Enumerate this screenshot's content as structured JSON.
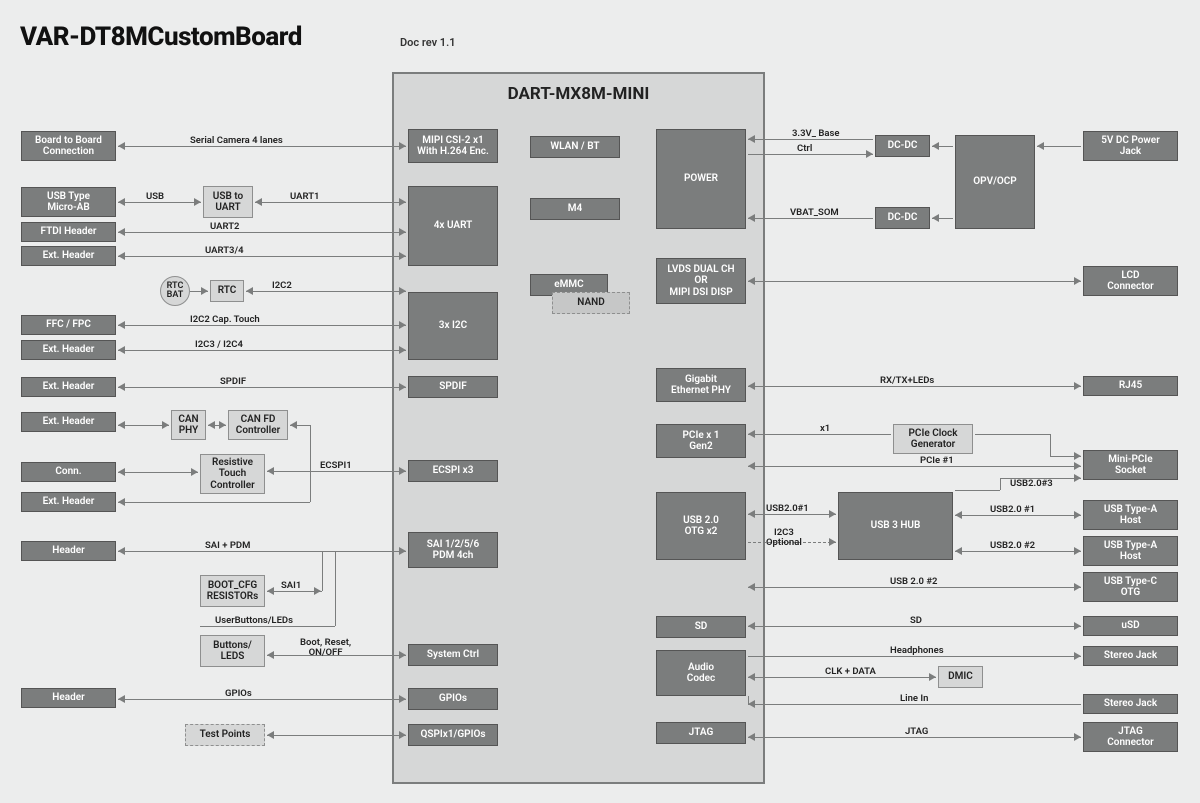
{
  "doc": {
    "title": "VAR-DT8MCustomBoard",
    "rev": "Doc rev 1.1",
    "som_title": "DART-MX8M-MINI"
  },
  "chart_data": {
    "type": "block-diagram",
    "title": "VAR-DT8MCustomBoard",
    "som": "DART-MX8M-MINI",
    "left_connectors": [
      "Board to Board Connection",
      "USB Type Micro-AB",
      "FTDI Header",
      "Ext. Header",
      "FFC / FPC",
      "Ext. Header",
      "Ext. Header",
      "Ext. Header",
      "Conn.",
      "Ext. Header",
      "Header",
      "Header"
    ],
    "left_aux_blocks": [
      "USB to UART",
      "RTC BAT",
      "RTC",
      "CAN PHY",
      "CAN FD Controller",
      "Resistive Touch Controller",
      "BOOT_CFG RESISTORs",
      "Buttons/ LEDS",
      "Test Points"
    ],
    "som_left_blocks": [
      "MIPI CSI-2 x1 With H.264 Enc.",
      "4x UART",
      "3x I2C",
      "SPDIF",
      "ECSPI x3",
      "SAI 1/2/5/6 PDM 4ch",
      "System Ctrl",
      "GPIOs",
      "QSPIx1/GPIOs"
    ],
    "som_center_blocks": [
      "WLAN / BT",
      "M4",
      "eMMC",
      "NAND"
    ],
    "som_right_blocks": [
      "POWER",
      "LVDS DUAL CH OR MIPI DSI DISP",
      "Gigabit Ethernet PHY",
      "PCIe x 1 Gen2",
      "USB 2.0 OTG x2",
      "SD",
      "Audio Codec",
      "JTAG"
    ],
    "right_aux_blocks": [
      "DC-DC",
      "DC-DC",
      "OPV/OCP",
      "PCIe Clock Generator",
      "USB 3 HUB",
      "DMIC"
    ],
    "right_connectors": [
      "5V DC Power Jack",
      "LCD Connector",
      "RJ45",
      "Mini-PCIe Socket",
      "USB Type-A Host",
      "USB Type-A Host",
      "USB Type-C OTG",
      "uSD",
      "Stereo Jack",
      "Stereo Jack",
      "JTAG Connector"
    ],
    "edges": [
      [
        "Board to Board Connection",
        "MIPI CSI-2 x1 With H.264 Enc.",
        "Serial Camera 4 lanes"
      ],
      [
        "USB Type Micro-AB",
        "USB to UART",
        "USB"
      ],
      [
        "USB to UART",
        "4x UART",
        "UART1"
      ],
      [
        "FTDI Header",
        "4x UART",
        "UART2"
      ],
      [
        "Ext. Header",
        "4x UART",
        "UART3/4"
      ],
      [
        "RTC BAT",
        "RTC",
        ""
      ],
      [
        "RTC",
        "3x I2C",
        "I2C2"
      ],
      [
        "FFC / FPC",
        "3x I2C",
        "I2C2 Cap. Touch"
      ],
      [
        "Ext. Header",
        "3x I2C",
        "I2C3 / I2C4"
      ],
      [
        "Ext. Header",
        "SPDIF",
        "SPDIF"
      ],
      [
        "Ext. Header",
        "CAN PHY",
        ""
      ],
      [
        "CAN PHY",
        "CAN FD Controller",
        ""
      ],
      [
        "Conn.",
        "Resistive Touch Controller",
        ""
      ],
      [
        "Resistive Touch Controller",
        "ECSPI x3",
        "ECSPI1"
      ],
      [
        "CAN FD Controller",
        "ECSPI x3",
        ""
      ],
      [
        "Ext. Header",
        "ECSPI x3",
        ""
      ],
      [
        "Header",
        "SAI 1/2/5/6 PDM 4ch",
        "SAI + PDM"
      ],
      [
        "BOOT_CFG RESISTORs",
        "SAI 1/2/5/6 PDM 4ch",
        "SAI1"
      ],
      [
        "Buttons/ LEDS",
        "SAI 1/2/5/6 PDM 4ch",
        "UserButtons/LEDs"
      ],
      [
        "Buttons/ LEDS",
        "System Ctrl",
        "Boot, Reset, ON/OFF"
      ],
      [
        "Header",
        "GPIOs",
        "GPIOs"
      ],
      [
        "Test Points",
        "QSPIx1/GPIOs",
        ""
      ],
      [
        "POWER",
        "DC-DC",
        "3.3V_ Base"
      ],
      [
        "POWER",
        "DC-DC",
        "Ctrl"
      ],
      [
        "POWER",
        "DC-DC",
        "VBAT_SOM"
      ],
      [
        "DC-DC",
        "OPV/OCP",
        ""
      ],
      [
        "DC-DC",
        "OPV/OCP",
        ""
      ],
      [
        "OPV/OCP",
        "5V DC Power Jack",
        ""
      ],
      [
        "LVDS DUAL CH OR MIPI DSI DISP",
        "LCD Connector",
        ""
      ],
      [
        "Gigabit Ethernet PHY",
        "RJ45",
        "RX/TX+LEDs"
      ],
      [
        "PCIe x 1 Gen2",
        "PCIe Clock Generator",
        "x1"
      ],
      [
        "PCIe Clock Generator",
        "Mini-PCIe Socket",
        ""
      ],
      [
        "PCIe x 1 Gen2",
        "Mini-PCIe Socket",
        "PCIe #1"
      ],
      [
        "USB 2.0 OTG x2",
        "USB 3 HUB",
        "USB2.0#1"
      ],
      [
        "USB 2.0 OTG x2",
        "USB 3 HUB",
        "I2C3 Optional"
      ],
      [
        "USB 3 HUB",
        "Mini-PCIe Socket",
        "USB2.0#3"
      ],
      [
        "USB 3 HUB",
        "USB Type-A Host",
        "USB2.0 #1"
      ],
      [
        "USB 3 HUB",
        "USB Type-A Host",
        "USB2.0 #2"
      ],
      [
        "USB 2.0 OTG x2",
        "USB Type-C OTG",
        "USB 2.0 #2"
      ],
      [
        "SD",
        "uSD",
        "SD"
      ],
      [
        "Audio Codec",
        "Stereo Jack",
        "Headphones"
      ],
      [
        "Audio Codec",
        "DMIC",
        "CLK + DATA"
      ],
      [
        "Audio Codec",
        "Stereo Jack",
        "Line In"
      ],
      [
        "JTAG",
        "JTAG Connector",
        "JTAG"
      ]
    ]
  },
  "left_conn": {
    "b2b": "Board to Board\nConnection",
    "usb_micro": "USB Type\nMicro-AB",
    "ftdi": "FTDI Header",
    "ext_uart": "Ext. Header",
    "ffc": "FFC / FPC",
    "ext_i2c": "Ext. Header",
    "ext_spdif": "Ext. Header",
    "ext_can": "Ext. Header",
    "conn_touch": "Conn.",
    "ext_ecspi": "Ext. Header",
    "hdr_sai": "Header",
    "hdr_gpio": "Header"
  },
  "left_aux": {
    "usb2uart": "USB to\nUART",
    "rtc_bat": "RTC\nBAT",
    "rtc": "RTC",
    "can_phy": "CAN\nPHY",
    "can_fd": "CAN FD\nController",
    "res_touch": "Resistive\nTouch\nController",
    "boot_cfg": "BOOT_CFG\nRESISTORs",
    "btn_led": "Buttons/\nLEDS",
    "testpts": "Test Points"
  },
  "som_left": {
    "mipi_csi": "MIPI CSI-2 x1\nWith H.264 Enc.",
    "uart": "4x UART",
    "i2c": "3x I2C",
    "spdif": "SPDIF",
    "ecspi": "ECSPI x3",
    "sai": "SAI 1/2/5/6\nPDM 4ch",
    "sysctrl": "System Ctrl",
    "gpios": "GPIOs",
    "qspi": "QSPIx1/GPIOs"
  },
  "som_center": {
    "wlan": "WLAN / BT",
    "m4": "M4",
    "emmc": "eMMC",
    "nand": "NAND"
  },
  "som_right": {
    "power": "POWER",
    "lvds": "LVDS DUAL CH\nOR\nMIPI DSI DISP",
    "eth": "Gigabit\nEthernet PHY",
    "pcie": "PCIe x 1\nGen2",
    "usbotg": "USB 2.0\nOTG x2",
    "sd": "SD",
    "audio": "Audio\nCodec",
    "jtag": "JTAG"
  },
  "right_aux": {
    "dcdc1": "DC-DC",
    "dcdc2": "DC-DC",
    "opv": "OPV/OCP",
    "pcie_clk": "PCIe Clock\nGenerator",
    "usb3hub": "USB 3 HUB",
    "dmic": "DMIC"
  },
  "right_conn": {
    "pwrjack": "5V DC Power\nJack",
    "lcd": "LCD\nConnector",
    "rj45": "RJ45",
    "mini_pcie": "Mini-PCIe\nSocket",
    "usba1": "USB Type-A\nHost",
    "usba2": "USB Type-A\nHost",
    "usbc": "USB Type-C\nOTG",
    "usd": "uSD",
    "sjack1": "Stereo Jack",
    "sjack2": "Stereo Jack",
    "jtag_conn": "JTAG\nConnector"
  },
  "labels": {
    "cam": "Serial Camera 4 lanes",
    "usb": "USB",
    "uart1": "UART1",
    "uart2": "UART2",
    "uart34": "UART3/4",
    "i2c2": "I2C2",
    "i2c_cap": "I2C2 Cap. Touch",
    "i2c34": "I2C3 / I2C4",
    "spdif": "SPDIF",
    "ecspi1": "ECSPI1",
    "sai_pdm": "SAI + PDM",
    "sai1": "SAI1",
    "userbtn": "UserButtons/LEDs",
    "boot_reset": "Boot, Reset,\nON/OFF",
    "gpios": "GPIOs",
    "v33_base": "3.3V_ Base",
    "ctrl": "Ctrl",
    "vbat_som": "VBAT_SOM",
    "rxtx": "RX/TX+LEDs",
    "x1": "x1",
    "pcie1": "PCIe #1",
    "usb20_1": "USB2.0#1",
    "usb20_3": "USB2.0#3",
    "usb20_s1": "USB2.0 #1",
    "usb20_s2": "USB2.0 #2",
    "i2c3_opt": "I2C3\nOptional",
    "usb20_2": "USB 2.0 #2",
    "sd": "SD",
    "hp": "Headphones",
    "clk_data": "CLK + DATA",
    "linein": "Line In",
    "jtag": "JTAG"
  }
}
